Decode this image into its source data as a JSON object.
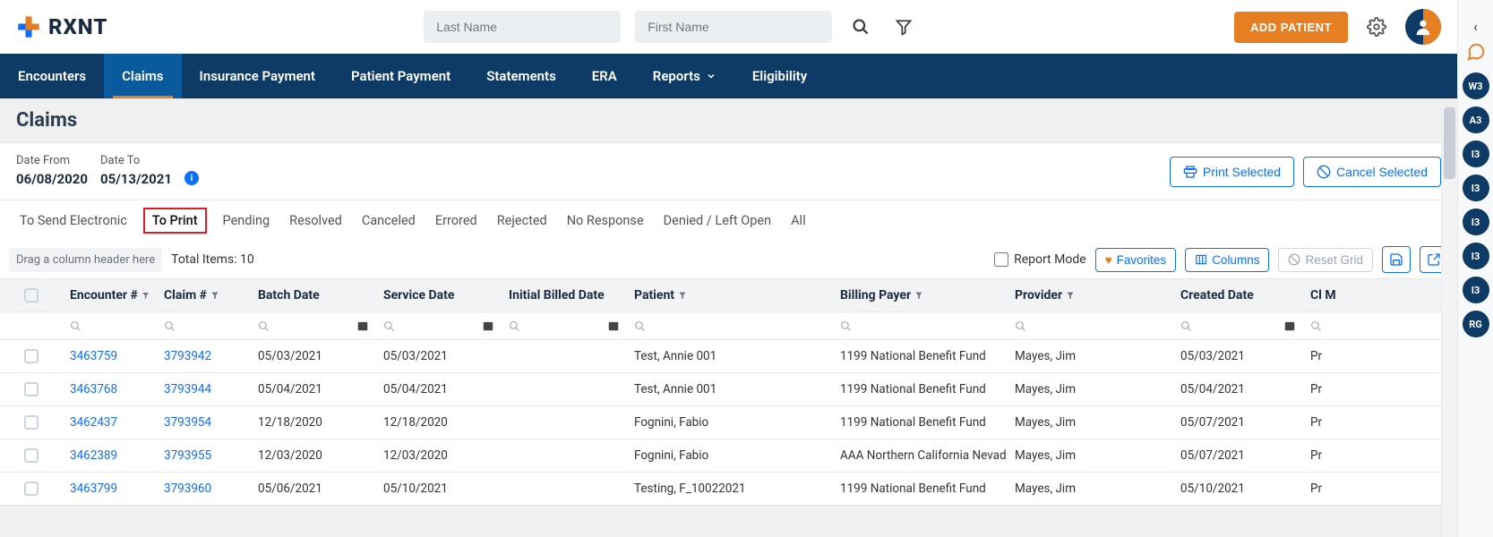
{
  "brand": "RXNT",
  "search": {
    "last_name_placeholder": "Last Name",
    "first_name_placeholder": "First Name"
  },
  "add_patient_label": "ADD PATIENT",
  "nav": {
    "encounters": "Encounters",
    "claims": "Claims",
    "insurance_payment": "Insurance Payment",
    "patient_payment": "Patient Payment",
    "statements": "Statements",
    "era": "ERA",
    "reports": "Reports",
    "eligibility": "Eligibility"
  },
  "page_title": "Claims",
  "dates": {
    "from_label": "Date From",
    "from_value": "06/08/2020",
    "to_label": "Date To",
    "to_value": "05/13/2021"
  },
  "actions": {
    "print_selected": "Print Selected",
    "cancel_selected": "Cancel Selected"
  },
  "tabs": {
    "to_send_electronic": "To Send Electronic",
    "to_print": "To Print",
    "pending": "Pending",
    "resolved": "Resolved",
    "canceled": "Canceled",
    "errored": "Errored",
    "rejected": "Rejected",
    "no_response": "No Response",
    "denied_left_open": "Denied / Left Open",
    "all": "All"
  },
  "grid_toolbar": {
    "drag_hint": "Drag a column header here",
    "total_items": "Total Items: 10",
    "report_mode": "Report Mode",
    "favorites": "Favorites",
    "columns": "Columns",
    "reset_grid": "Reset Grid"
  },
  "columns": {
    "encounter": "Encounter #",
    "claim": "Claim #",
    "batch_date": "Batch Date",
    "service_date": "Service Date",
    "initial_billed_date": "Initial Billed Date",
    "patient": "Patient",
    "billing_payer": "Billing Payer",
    "provider": "Provider",
    "created_date": "Created Date",
    "last": "Cl M"
  },
  "rows": [
    {
      "encounter": "3463759",
      "claim": "3793942",
      "batch_date": "05/03/2021",
      "service_date": "05/03/2021",
      "initial_billed_date": "",
      "patient": "Test, Annie 001",
      "billing_payer": "1199 National Benefit Fund",
      "provider": "Mayes, Jim",
      "created_date": "05/03/2021",
      "last": "Pr"
    },
    {
      "encounter": "3463768",
      "claim": "3793944",
      "batch_date": "05/04/2021",
      "service_date": "05/04/2021",
      "initial_billed_date": "",
      "patient": "Test, Annie 001",
      "billing_payer": "1199 National Benefit Fund",
      "provider": "Mayes, Jim",
      "created_date": "05/04/2021",
      "last": "Pr"
    },
    {
      "encounter": "3462437",
      "claim": "3793954",
      "batch_date": "12/18/2020",
      "service_date": "12/18/2020",
      "initial_billed_date": "",
      "patient": "Fognini, Fabio",
      "billing_payer": "1199 National Benefit Fund",
      "provider": "Mayes, Jim",
      "created_date": "05/07/2021",
      "last": "Pr"
    },
    {
      "encounter": "3462389",
      "claim": "3793955",
      "batch_date": "12/03/2020",
      "service_date": "12/03/2020",
      "initial_billed_date": "",
      "patient": "Fognini, Fabio",
      "billing_payer": "AAA Northern California Nevad...",
      "provider": "Mayes, Jim",
      "created_date": "05/07/2021",
      "last": "Pr"
    },
    {
      "encounter": "3463799",
      "claim": "3793960",
      "batch_date": "05/06/2021",
      "service_date": "05/10/2021",
      "initial_billed_date": "",
      "patient": "Testing, F_10022021",
      "billing_payer": "1199 National Benefit Fund",
      "provider": "Mayes, Jim",
      "created_date": "05/10/2021",
      "last": "Pr"
    }
  ],
  "sidebar_badges": [
    "W3",
    "A3",
    "I3",
    "I3",
    "I3",
    "I3",
    "I3",
    "RG"
  ],
  "colors": {
    "orange": "#e67e22",
    "navy": "#0d3b66",
    "blue": "#0d6efd",
    "red": "#e31b23"
  }
}
